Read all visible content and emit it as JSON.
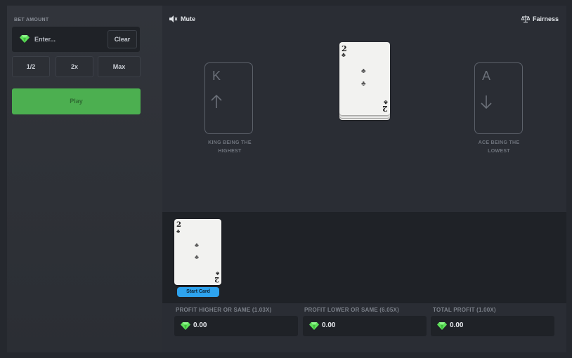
{
  "bet": {
    "label": "BET AMOUNT",
    "placeholder": "Enter...",
    "clear_label": "Clear",
    "half_label": "1/2",
    "double_label": "2x",
    "max_label": "Max",
    "play_label": "Play"
  },
  "top": {
    "mute_label": "Mute",
    "fairness_label": "Fairness"
  },
  "guides": {
    "high": {
      "letter": "K",
      "text_line1": "KING BEING THE",
      "text_line2": "HIGHEST"
    },
    "low": {
      "letter": "A",
      "text_line1": "ACE BEING THE",
      "text_line2": "LOWEST"
    }
  },
  "current_card": {
    "rank": "2",
    "suit": "♣"
  },
  "history": {
    "cards": [
      {
        "rank": "2",
        "suit": "♣",
        "badge": "Start Card"
      }
    ]
  },
  "profits": [
    {
      "label": "PROFIT HIGHER OR SAME (1.03X)",
      "value": "0.00"
    },
    {
      "label": "PROFIT LOWER OR SAME (6.05X)",
      "value": "0.00"
    },
    {
      "label": "TOTAL PROFIT (1.00X)",
      "value": "0.00"
    }
  ],
  "colors": {
    "accent_green": "#4caf50",
    "gem_green": "#5ee05a",
    "badge_blue": "#2ea3ee"
  },
  "icons": {
    "gem": "gem-icon",
    "mute": "speaker-icon",
    "fairness": "scale-icon",
    "up": "arrow-up-icon",
    "down": "arrow-down-icon"
  }
}
